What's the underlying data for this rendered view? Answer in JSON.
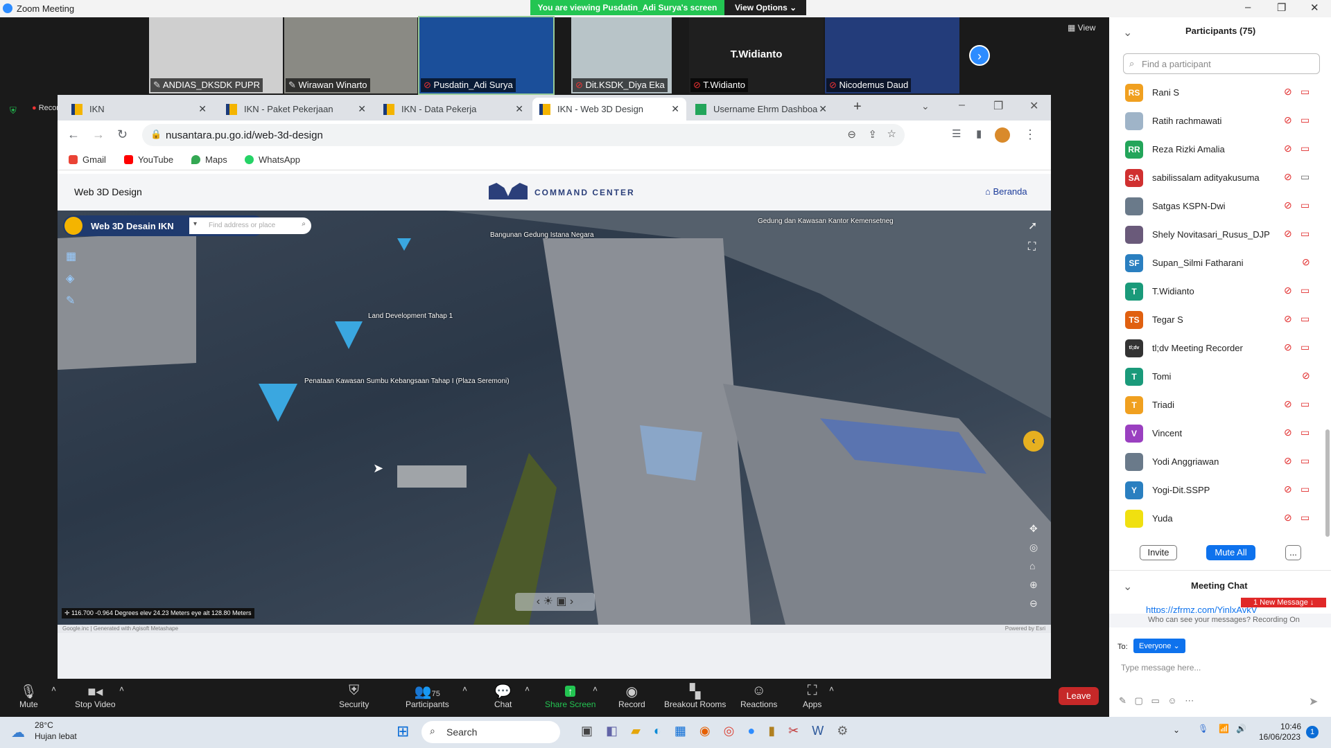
{
  "zoom": {
    "title": "Zoom Meeting",
    "banner": "You are viewing Pusdatin_Adi Surya's screen",
    "view_options": "View Options",
    "view": "View",
    "recording": "Recording"
  },
  "videos": [
    {
      "name": "ANDIAS_DKSDK PUPR",
      "bg": "#cfcfcf"
    },
    {
      "name": "Wirawan Winarto",
      "bg": "#8a8a84"
    },
    {
      "name": "Pusdatin_Adi Surya",
      "bg": "#1b4f9a"
    },
    {
      "name": "Dit.KSDK_Diya Eka",
      "bg": "#b8c4c8"
    },
    {
      "name": "T.Widianto",
      "bg": "#1f1f1f",
      "label": "T.Widianto"
    },
    {
      "name": "Nicodemus Daud",
      "bg": "#233c7a"
    }
  ],
  "browser": {
    "tabs": [
      {
        "label": "IKN"
      },
      {
        "label": "IKN - Paket Pekerjaan"
      },
      {
        "label": "IKN - Data Pekerja"
      },
      {
        "label": "IKN - Web 3D Design"
      },
      {
        "label": "Username Ehrm Dashboa"
      }
    ],
    "url": "nusantara.pu.go.id/web-3d-design",
    "bookmarks": [
      {
        "label": "Gmail",
        "color": "#ea4335"
      },
      {
        "label": "YouTube",
        "color": "#ff0000"
      },
      {
        "label": "Maps",
        "color": "#34a853"
      },
      {
        "label": "WhatsApp",
        "color": "#25d366"
      }
    ]
  },
  "page": {
    "title": "Web 3D Design",
    "brand": "COMMAND CENTER",
    "home": "Beranda"
  },
  "map": {
    "app_title": "Web 3D Desain IKN",
    "search_placeholder": "Find address or place",
    "labels": [
      "Bangunan Gedung Istana Negara",
      "Gedung dan Kawasan Kantor Kemensetneg",
      "Land Development Tahap 1",
      "Penataan Kawasan Sumbu Kebangsaan Tahap I (Plaza Seremoni)"
    ],
    "coords": "116.700 -0.964 Degrees  elev 24.23 Meters  eye alt 128.80 Meters",
    "credit": "Google.inc | Generated with Agisoft Metashape",
    "powered": "Powered by Esri"
  },
  "toolbar": {
    "mute": "Mute",
    "stop_video": "Stop Video",
    "security": "Security",
    "participants": "Participants",
    "participants_count": "75",
    "chat": "Chat",
    "share": "Share Screen",
    "record": "Record",
    "breakout": "Breakout Rooms",
    "reactions": "Reactions",
    "apps": "Apps",
    "leave": "Leave"
  },
  "panel": {
    "title": "Participants (75)",
    "search_placeholder": "Find a participant",
    "participants": [
      {
        "initials": "RS",
        "name": "Rani S",
        "color": "#f0a020",
        "video": true
      },
      {
        "initials": "",
        "name": "Ratih rachmawati",
        "color": "#9fb4c8",
        "video": true
      },
      {
        "initials": "RR",
        "name": "Reza Rizki Amalia",
        "color": "#23a55a",
        "video": true
      },
      {
        "initials": "SA",
        "name": "sabilissalam adityakusuma",
        "color": "#d03030",
        "video": true,
        "video_on": true
      },
      {
        "initials": "",
        "name": "Satgas KSPN-Dwi",
        "color": "#6a7a8a",
        "video": true
      },
      {
        "initials": "",
        "name": "Shely Novitasari_Rusus_DJP",
        "color": "#6a5a7a",
        "video": true
      },
      {
        "initials": "SF",
        "name": "Supan_Silmi Fatharani",
        "color": "#2a7fc0",
        "video": false
      },
      {
        "initials": "T",
        "name": "T.Widianto",
        "color": "#1a9a7a",
        "video": true
      },
      {
        "initials": "TS",
        "name": "Tegar S",
        "color": "#e06010",
        "video": true
      },
      {
        "initials": "tl;dv",
        "name": "tl;dv Meeting Recorder",
        "color": "#333",
        "video": true
      },
      {
        "initials": "T",
        "name": "Tomi",
        "color": "#1a9a7a",
        "video": false
      },
      {
        "initials": "T",
        "name": "Triadi",
        "color": "#f0a020",
        "video": true
      },
      {
        "initials": "V",
        "name": "Vincent",
        "color": "#9a40c0",
        "video": true
      },
      {
        "initials": "",
        "name": "Yodi Anggriawan",
        "color": "#6a7a8a",
        "video": true
      },
      {
        "initials": "Y",
        "name": "Yogi-Dit.SSPP",
        "color": "#2a7fc0",
        "video": true
      },
      {
        "initials": "",
        "name": "Yuda",
        "color": "#f0e010",
        "video": true
      }
    ],
    "invite": "Invite",
    "mute_all": "Mute All",
    "more": "...",
    "chat_title": "Meeting Chat",
    "chat_link": "https://zfrmz.com/YinlxAvkV",
    "new_message": "1 New Message",
    "who_can_see": "Who can see your messages? Recording On",
    "to": "To:",
    "to_value": "Everyone",
    "chat_placeholder": "Type message here..."
  },
  "taskbar": {
    "temp": "28°C",
    "weather": "Hujan lebat",
    "search": "Search",
    "time": "10:46",
    "date": "16/06/2023",
    "notif": "1"
  }
}
